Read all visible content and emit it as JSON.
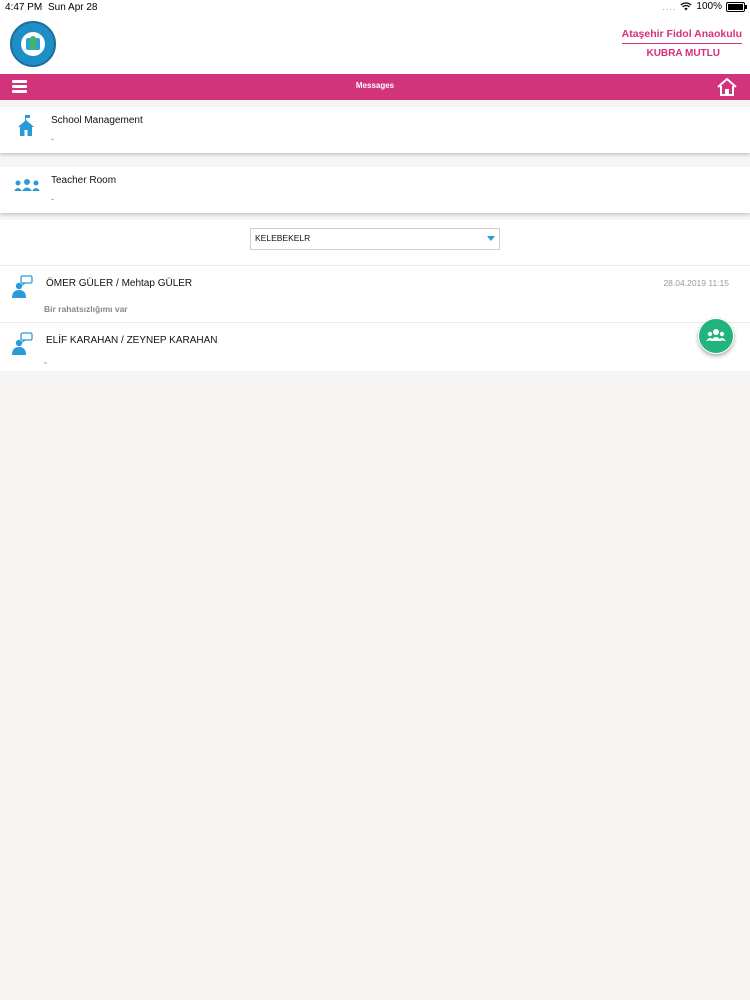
{
  "status_bar": {
    "time": "4:47 PM",
    "date": "Sun Apr 28",
    "signal": "....",
    "battery": "100%"
  },
  "header": {
    "school_name": "Ataşehir Fidol Anaokulu",
    "user_name": "KUBRA MUTLU",
    "logo_icon": "school-logo"
  },
  "nav": {
    "title": "Messages",
    "menu_icon": "hamburger-menu-icon",
    "home_icon": "home-icon",
    "color": "#d2347c"
  },
  "rooms": [
    {
      "title": "School Management",
      "subtitle": "-",
      "icon": "school-building-icon"
    },
    {
      "title": "Teacher Room",
      "subtitle": "-",
      "icon": "people-group-icon"
    }
  ],
  "filter": {
    "selected": "KELEBEKELR",
    "arrow_icon": "dropdown-arrow-icon"
  },
  "messages": [
    {
      "sender": "ÖMER GÜLER / Mehtap GÜLER",
      "preview": "Bir rahatsızlığımı var",
      "timestamp": "28.04.2019 11:15",
      "icon": "chat-user-icon"
    },
    {
      "sender": "ELİF KARAHAN / ZEYNEP KARAHAN",
      "preview": "-",
      "timestamp": "",
      "icon": "chat-user-icon"
    }
  ],
  "fab": {
    "icon": "users-group-icon",
    "color": "#21b47d"
  },
  "colors": {
    "accent": "#d2347c",
    "icon_blue": "#2b9bd7",
    "background": "#f7f4f4"
  }
}
